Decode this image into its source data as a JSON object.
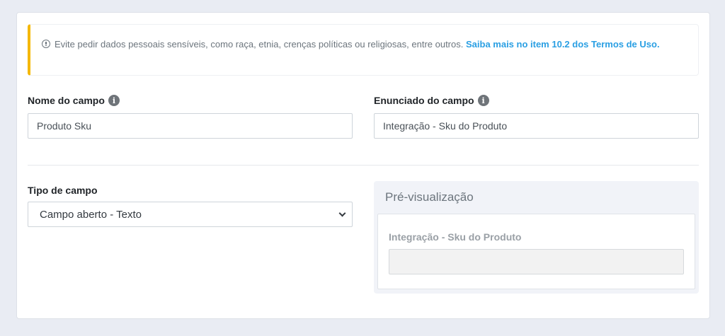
{
  "alert": {
    "text": "Evite pedir dados pessoais sensíveis, como raça, etnia, crenças políticas ou religiosas, entre outros.",
    "link": "Saiba mais no item 10.2 dos Termos de Uso.",
    "accent_color": "#f5b800",
    "icon": "exclamation-circle-icon"
  },
  "field_name": {
    "label": "Nome do campo",
    "value": "Produto Sku",
    "info_glyph": "i",
    "icon": "info-icon"
  },
  "field_statement": {
    "label": "Enunciado do campo",
    "value": "Integração - Sku do Produto",
    "info_glyph": "i",
    "icon": "info-icon"
  },
  "field_type": {
    "label": "Tipo de campo",
    "selected": "Campo aberto - Texto",
    "icon": "chevron-down-icon"
  },
  "preview": {
    "title": "Pré-visualização",
    "label": "Integração - Sku do Produto"
  },
  "colors": {
    "link": "#2a9fe3",
    "background": "#e9ecf3"
  }
}
